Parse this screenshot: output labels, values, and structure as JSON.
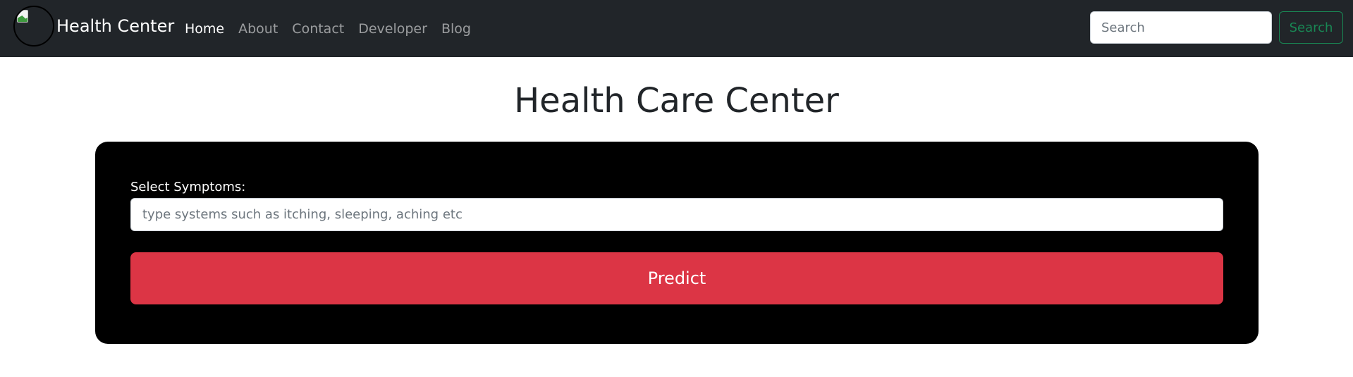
{
  "navbar": {
    "brand": "Health Center",
    "links": [
      {
        "label": "Home",
        "active": true
      },
      {
        "label": "About",
        "active": false
      },
      {
        "label": "Contact",
        "active": false
      },
      {
        "label": "Developer",
        "active": false
      },
      {
        "label": "Blog",
        "active": false
      }
    ],
    "search": {
      "placeholder": "Search",
      "value": "",
      "button_label": "Search"
    }
  },
  "main": {
    "title": "Health Care Center",
    "form": {
      "label": "Select Symptoms:",
      "placeholder": "type systems such as itching, sleeping, aching etc",
      "value": "",
      "submit_label": "Predict"
    }
  },
  "colors": {
    "navbar_bg": "#212529",
    "card_bg": "#000000",
    "predict_button": "#dc3545",
    "search_button": "#198754"
  },
  "icons": {
    "logo": "broken-image-icon"
  }
}
